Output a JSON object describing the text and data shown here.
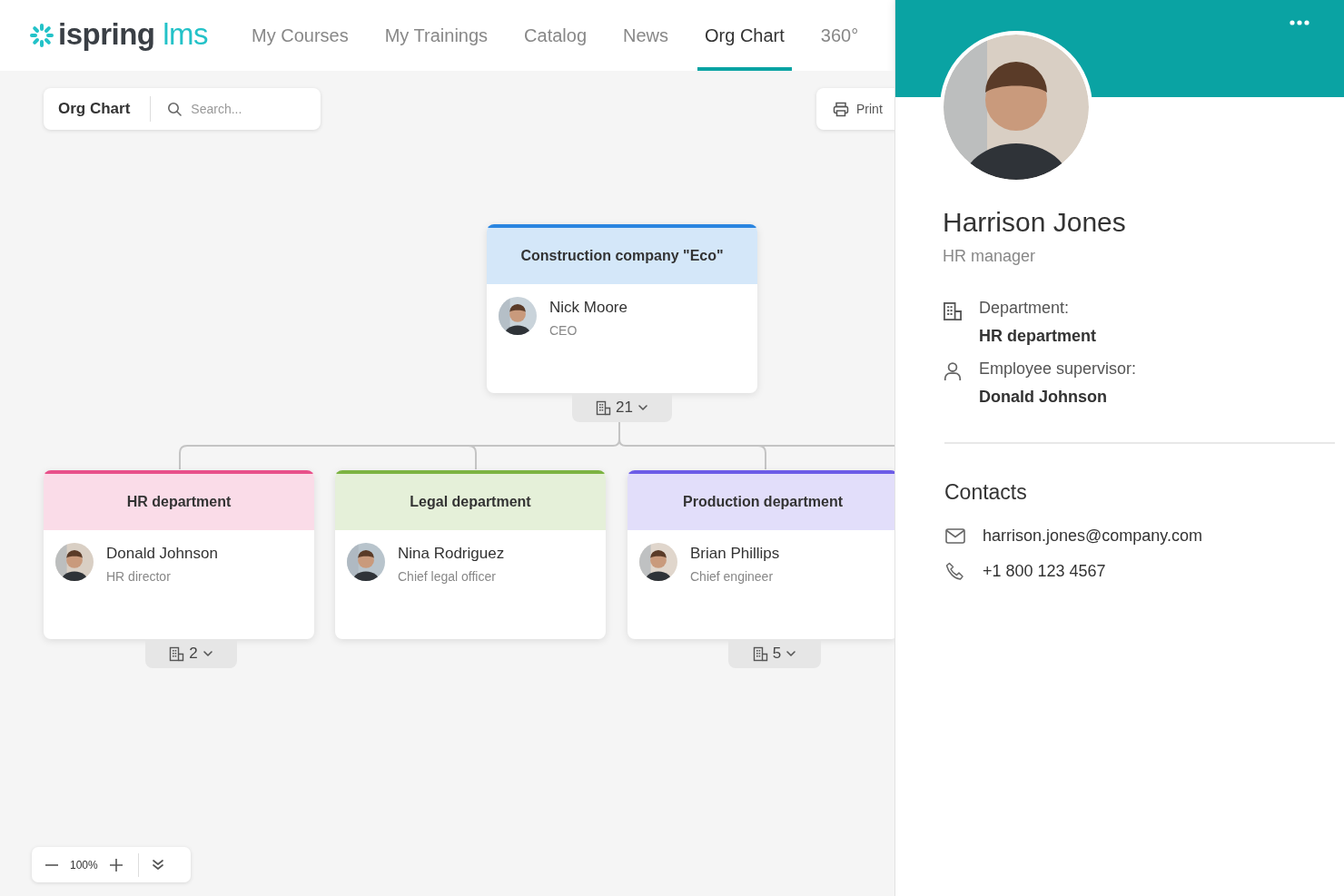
{
  "logo": {
    "name": "ispring",
    "suffix": "lms"
  },
  "nav": [
    {
      "label": "My Courses",
      "selected": false
    },
    {
      "label": "My Trainings",
      "selected": false
    },
    {
      "label": "Catalog",
      "selected": false
    },
    {
      "label": "News",
      "selected": false
    },
    {
      "label": "Org Chart",
      "selected": true
    },
    {
      "label": "360°",
      "selected": false
    }
  ],
  "toolbar": {
    "title": "Org Chart",
    "search": {
      "placeholder": "Search..."
    },
    "print": "Print"
  },
  "org_chart": {
    "department": "Construction company \"Eco\"",
    "color": "#2a85e0",
    "person": {
      "name": "Nick Moore",
      "role": "CEO"
    },
    "count": "21",
    "children": [
      {
        "department": "HR department",
        "color": "#e8508a",
        "person": {
          "name": "Donald Johnson",
          "role": "HR director"
        },
        "count": "2"
      },
      {
        "department": "Legal department",
        "color": "#7cb342",
        "person": {
          "name": "Nina Rodriguez",
          "role": "Chief legal officer"
        }
      },
      {
        "department": "Production department",
        "color": "#6c5ce7",
        "person": {
          "name": "Brian Phillips",
          "role": "Chief engineer"
        },
        "count": "5"
      }
    ]
  },
  "zoom": {
    "value": "100%"
  },
  "profile": {
    "name": "Harrison Jones",
    "title": "HR manager",
    "details": [
      {
        "kind": "department",
        "label": "Department:",
        "value": "HR department"
      },
      {
        "kind": "supervisor",
        "label": "Employee supervisor:",
        "value": "Donald Johnson"
      }
    ],
    "contacts": {
      "heading": "Contacts",
      "items": [
        {
          "kind": "email",
          "value": "harrison.jones@company.com"
        },
        {
          "kind": "phone",
          "value": "+1 800 123 4567"
        }
      ]
    }
  }
}
